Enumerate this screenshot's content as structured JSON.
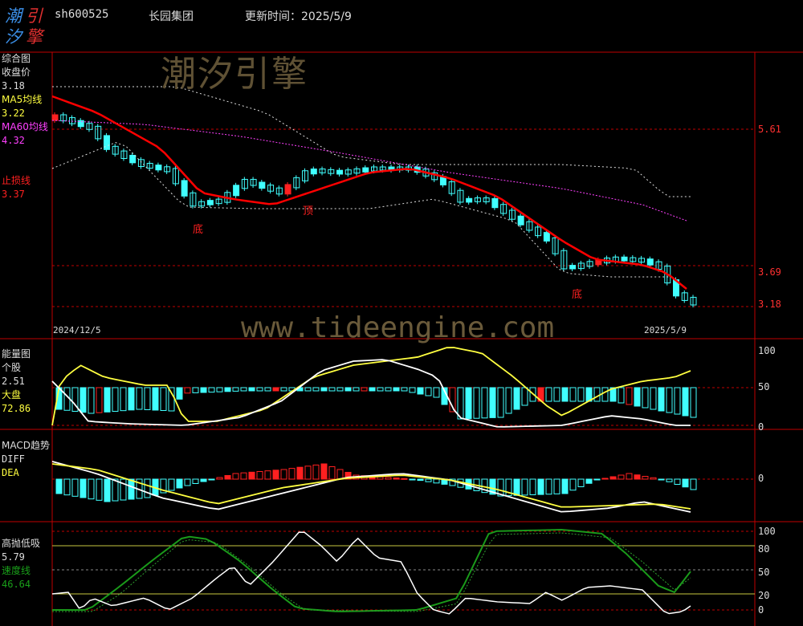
{
  "header": {
    "logo_chars": [
      "潮",
      "引",
      "汐",
      "擎"
    ],
    "stock_code": "sh600525",
    "stock_name": "长园集团",
    "update_label": "更新时间：2025/5/9"
  },
  "watermarks": {
    "brand": "潮汐引擎",
    "url": "www.tideengine.com"
  },
  "colors": {
    "background": "#000000",
    "frame_red": "#c00000",
    "price_up": "#ff2020",
    "price_down": "#40ffff",
    "ma5": "#ffff40",
    "ma60": "#ff40ff",
    "stop_loss": "#ff0000",
    "speed_green": "#1a9a1a"
  },
  "panel_price": {
    "title": "综合图",
    "close_label": "收盘价",
    "close_value": "3.18",
    "ma5_label": "MA5均线",
    "ma5_value": "3.22",
    "ma60_label": "MA60均线",
    "ma60_value": "4.32",
    "stop_label": "止损线",
    "stop_value": "3.37",
    "right_ticks": [
      "5.61",
      "3.69",
      "3.18"
    ],
    "date_start": "2024/12/5",
    "date_end": "2025/5/9",
    "markers": [
      "底",
      "顶",
      "底"
    ]
  },
  "panel_energy": {
    "title": "能量图",
    "stock_label": "个股",
    "stock_value": "2.51",
    "market_label": "大盘",
    "market_value": "72.86",
    "right_ticks": [
      "100",
      "50",
      "0"
    ]
  },
  "panel_macd": {
    "title": "MACD趋势",
    "diff_label": "DIFF",
    "dea_label": "DEA",
    "right_ticks": [
      "0"
    ]
  },
  "panel_osc": {
    "title": "高抛低吸",
    "value": "5.79",
    "speed_label": "速度线",
    "speed_value": "46.64",
    "right_ticks": [
      "100",
      "80",
      "50",
      "20",
      "0"
    ]
  }
}
